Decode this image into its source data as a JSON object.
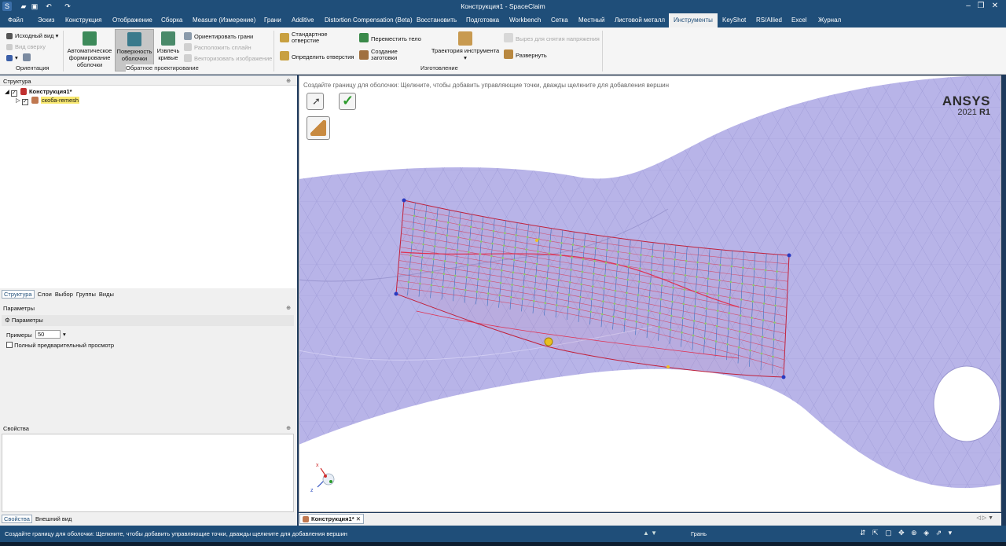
{
  "app": {
    "title": "Конструкция1 - SpaceClaim"
  },
  "menu": {
    "tabs": [
      "Файл",
      "Эскиз",
      "Конструкция",
      "Отображение",
      "Сборка",
      "Measure (Измерение)",
      "Грани",
      "Additive",
      "Distortion Compensation (Beta)",
      "Восстановить",
      "Подготовка",
      "Workbench",
      "Сетка",
      "Местный",
      "Листовой металл",
      "Инструменты",
      "KeyShot",
      "RS/Allied",
      "Excel",
      "Журнал"
    ],
    "active": "Инструменты"
  },
  "ribbon": {
    "orient": {
      "home_view": "Исходный вид",
      "top_view": "Вид сверху",
      "group": "Ориентация"
    },
    "reverse": {
      "auto_skin": "Автоматическое формирование оболочки",
      "skin_surface": "Поверхность оболочки",
      "extract_curves": "Извлечь кривые",
      "orient_faces": "Ориентировать грани",
      "place_spline": "Расположить сплайн",
      "vectorize_image": "Векторизовать изображение",
      "group": "Обратное проектирование"
    },
    "manufacturing": {
      "std_hole": "Стандартное отверстие",
      "identify_holes": "Определить отверстия",
      "move_body": "Переместить тело",
      "create_stock": "Создание заготовки",
      "tool_path": "Траектория инструмента",
      "relief_cut": "Вырез для снятия напряжения",
      "unfold": "Развернуть",
      "group": "Изготовление"
    }
  },
  "structure": {
    "header": "Структура",
    "root": "Конструкция1*",
    "child": "скоба-remesh",
    "tabs": [
      "Структура",
      "Слои",
      "Выбор",
      "Группы",
      "Виды"
    ]
  },
  "parameters": {
    "header": "Параметры",
    "section": "Параметры",
    "samples_label": "Примеры",
    "samples_value": "50",
    "full_preview": "Полный предварительный просмотр"
  },
  "properties": {
    "header": "Свойства",
    "tabs": [
      "Свойства",
      "Внешний вид"
    ]
  },
  "viewport": {
    "hint": "Создайте границу для оболочки: Щелкните, чтобы добавить управляющие точки, дважды щелкните для добавления вершин",
    "brand": "ANSYS",
    "version": "2021",
    "release": "R1",
    "axis_x": "x",
    "axis_z": "z"
  },
  "doc_tab": {
    "label": "Конструкция1*"
  },
  "status": {
    "message": "Создайте границу для оболочки: Щелкните, чтобы добавить управляющие точки, дважды щелкните для добавления вершин",
    "selection": "Грань"
  },
  "icons": [
    "app-icon",
    "folder-icon",
    "save-icon",
    "undo-icon",
    "redo-icon",
    "minimize-icon",
    "restore-icon",
    "close-icon",
    "home-icon",
    "cube-icon",
    "auto-skin-icon",
    "skin-surface-icon",
    "extract-curves-icon",
    "orient-faces-icon",
    "hole-icon",
    "move-body-icon",
    "stock-icon",
    "tool-path-icon",
    "unfold-icon",
    "select-arrow-icon",
    "check-icon",
    "select-boundary-icon",
    "pin-icon",
    "gear-icon"
  ],
  "colors": {
    "brand_blue": "#1f4e79",
    "mesh_fill": "#b8b4e8",
    "boundary_red": "#c0203a",
    "check_green": "#2a9a2a"
  }
}
